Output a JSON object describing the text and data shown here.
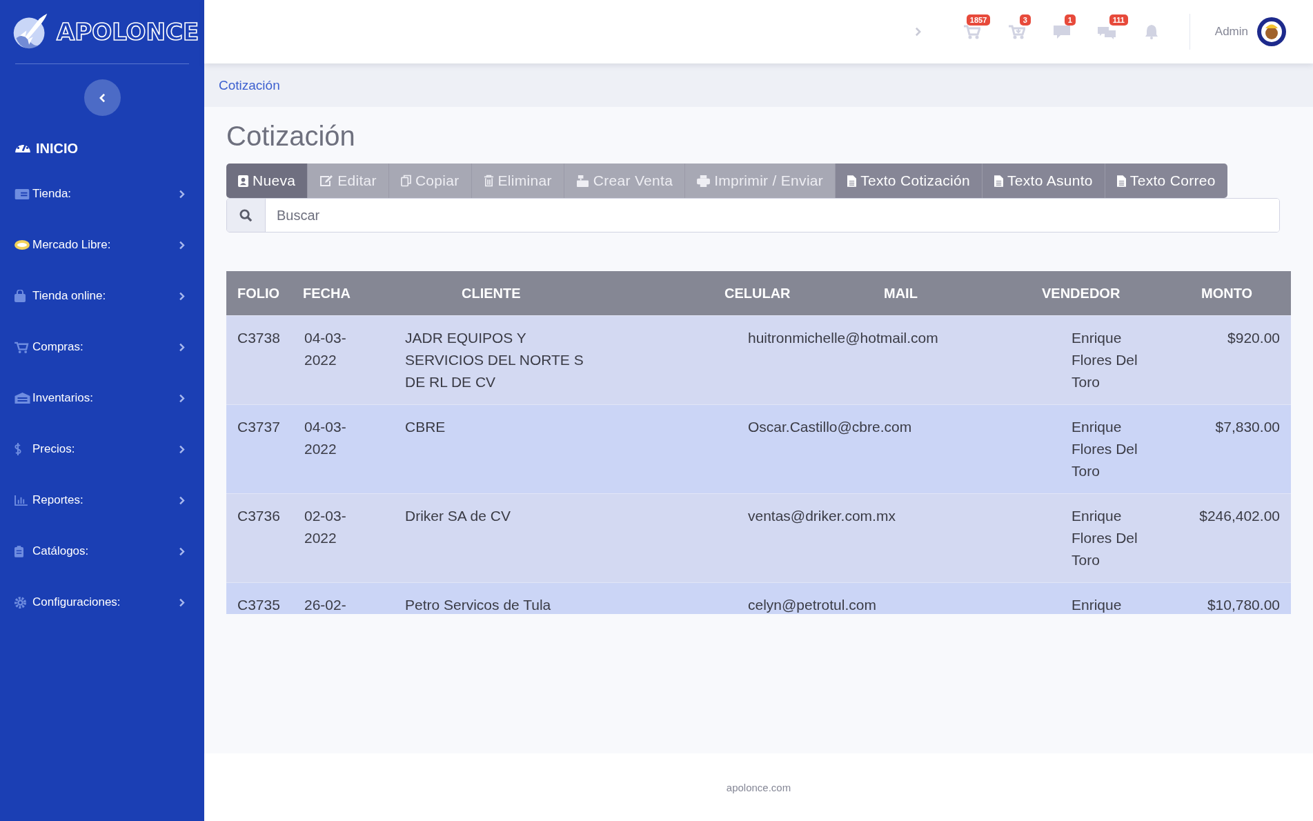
{
  "brand": {
    "name": "APOLONCE"
  },
  "sidebar": {
    "home": "INICIO",
    "items": [
      {
        "label": "Tienda:",
        "expanded": false
      },
      {
        "label": "Mercado Libre:",
        "expanded": false
      },
      {
        "label": "Tienda online:",
        "expanded": false
      },
      {
        "label": "Compras:",
        "expanded": false
      },
      {
        "label": "Inventarios:",
        "expanded": false
      },
      {
        "label": "Precios:",
        "expanded": false
      },
      {
        "label": "Reportes:",
        "expanded": false
      },
      {
        "label": "Catálogos:",
        "expanded": false
      },
      {
        "label": "Configuraciones:",
        "expanded": false
      }
    ]
  },
  "topbar": {
    "alerts": [
      {
        "kind": "cart",
        "badge": "1857"
      },
      {
        "kind": "cart-down",
        "badge": "3"
      },
      {
        "kind": "message",
        "badge": "1"
      },
      {
        "kind": "messages",
        "badge": "111"
      },
      {
        "kind": "bell"
      }
    ],
    "user": "Admin"
  },
  "breadcrumb": "Cotización",
  "title": "Cotización",
  "toolbar": [
    {
      "label": "Nueva",
      "disabled": false
    },
    {
      "label": "Editar",
      "disabled": true
    },
    {
      "label": "Copiar",
      "disabled": true
    },
    {
      "label": "Eliminar",
      "disabled": true
    },
    {
      "label": "Crear Venta",
      "disabled": true
    },
    {
      "label": "Imprimir / Enviar",
      "disabled": true
    },
    {
      "label": "Texto Cotización",
      "disabled": false
    },
    {
      "label": "Texto Asunto",
      "disabled": false
    },
    {
      "label": "Texto Correo",
      "disabled": false
    }
  ],
  "search": {
    "placeholder": "Buscar"
  },
  "table": {
    "columns": [
      "FOLIO",
      "FECHA",
      "CLIENTE",
      "CELULAR",
      "MAIL",
      "VENDEDOR",
      "MONTO"
    ],
    "rows": [
      {
        "folio": "C3738",
        "fecha": "04-03-2022",
        "cliente": "JADR EQUIPOS Y SERVICIOS DEL NORTE S DE RL DE CV",
        "mail": "huitronmichelle@hotmail.com",
        "vendedor": "Enrique Flores Del Toro",
        "monto": "$920.00"
      },
      {
        "folio": "C3737",
        "fecha": "04-03-2022",
        "cliente": "CBRE",
        "mail": "Oscar.Castillo@cbre.com",
        "vendedor": "Enrique Flores Del Toro",
        "monto": "$7,830.00"
      },
      {
        "folio": "C3736",
        "fecha": "02-03-2022",
        "cliente": "Driker SA de CV",
        "mail": "ventas@driker.com.mx",
        "vendedor": "Enrique Flores Del Toro",
        "monto": "$246,402.00"
      },
      {
        "folio": "C3735",
        "fecha": "26-02-",
        "cliente": "Petro Servicos de Tula",
        "mail": "celyn@petrotul.com",
        "vendedor": "Enrique",
        "monto": "$10,780.00"
      }
    ]
  },
  "footer": "apolonce.com"
}
